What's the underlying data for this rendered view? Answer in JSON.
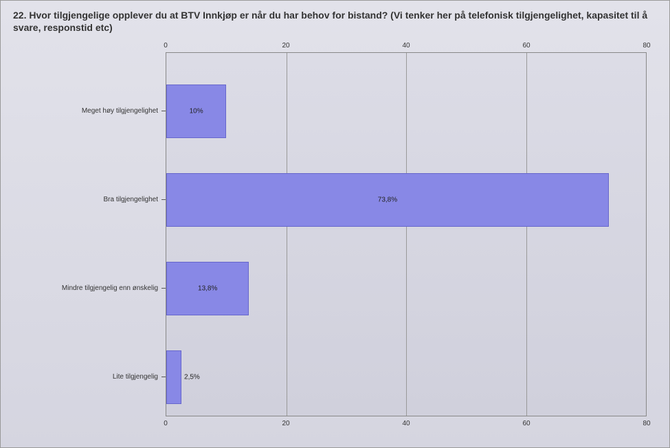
{
  "chart_data": {
    "type": "bar",
    "title": "22. Hvor tilgjengelige opplever du at BTV Innkjøp er når du har behov for bistand? (Vi tenker her på telefonisk tilgjengelighet, kapasitet til å svare, responstid etc)",
    "categories": [
      "Meget høy tilgjengelighet",
      "Bra tilgjengelighet",
      "Mindre tilgjengelig enn ønskelig",
      "Lite tilgjengelig"
    ],
    "values": [
      10,
      73.8,
      13.8,
      2.5
    ],
    "value_labels": [
      "10%",
      "73,8%",
      "13,8%",
      "2,5%"
    ],
    "xlabel": "",
    "ylabel": "",
    "xlim": [
      0,
      80
    ],
    "x_ticks": [
      0,
      20,
      40,
      60,
      80
    ],
    "orientation": "horizontal"
  }
}
